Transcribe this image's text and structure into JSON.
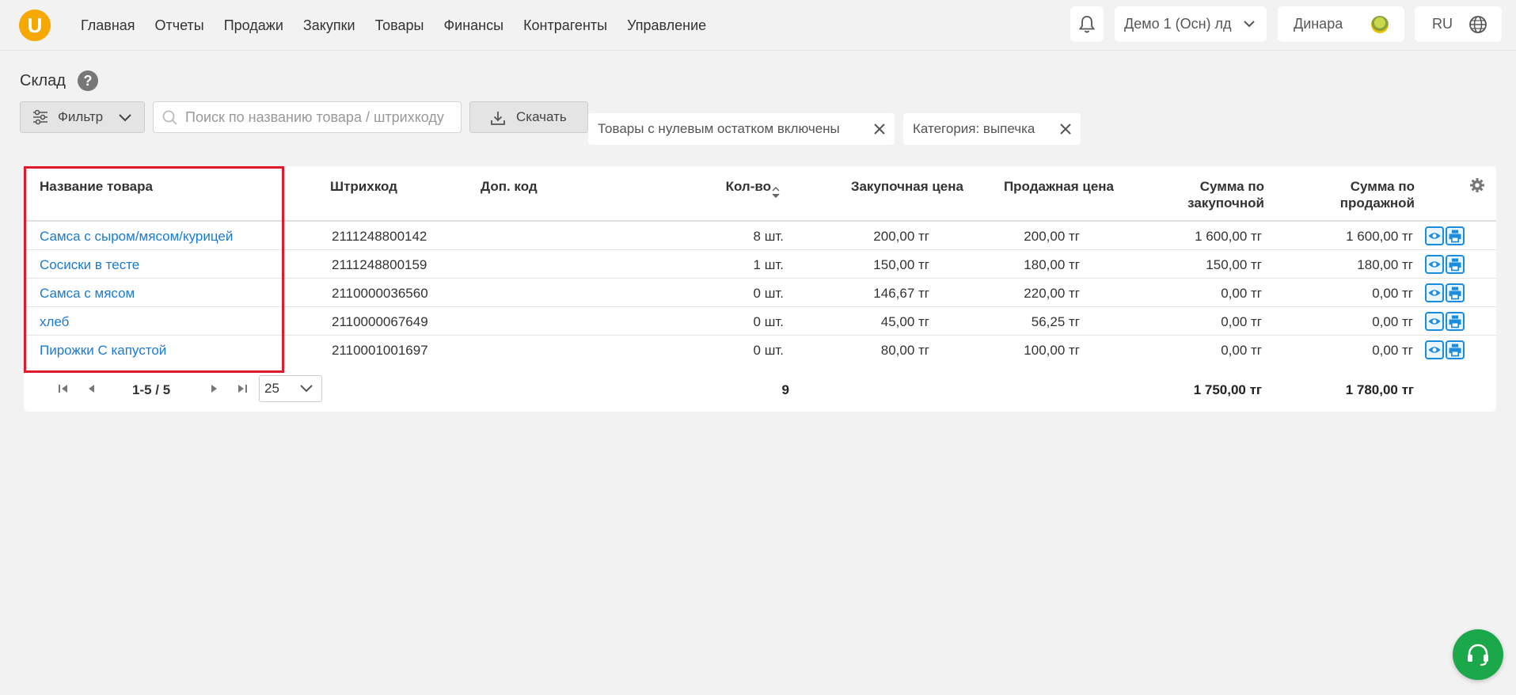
{
  "header": {
    "logo_letter": "U",
    "nav": [
      "Главная",
      "Отчеты",
      "Продажи",
      "Закупки",
      "Товары",
      "Финансы",
      "Контрагенты",
      "Управление"
    ],
    "company": "Демо 1 (Осн) лд",
    "user": "Динара",
    "language": "RU"
  },
  "page": {
    "title": "Склад",
    "help": "?",
    "filter_label": "Фильтр",
    "search_placeholder": "Поиск по названию товара / штрихкоду",
    "download_label": "Скачать",
    "chips": [
      "Товары с нулевым остатком включены",
      "Категория: выпечка"
    ]
  },
  "table": {
    "columns": {
      "name": "Название товара",
      "barcode": "Штрихкод",
      "extra_code": "Доп. код",
      "qty": "Кол-во",
      "purchase_price": "Закупочная цена",
      "sale_price": "Продажная цена",
      "sum_purchase_1": "Сумма по",
      "sum_purchase_2": "закупочной",
      "sum_sale_1": "Сумма по",
      "sum_sale_2": "продажной"
    },
    "rows": [
      {
        "name": "Самса с сыром/мясом/курицей",
        "barcode": "2111248800142",
        "extra_code": "",
        "qty": "8 шт.",
        "purchase_price": "200,00 тг",
        "sale_price": "200,00 тг",
        "sum_purchase": "1 600,00 тг",
        "sum_sale": "1 600,00 тг"
      },
      {
        "name": "Сосиски в тесте",
        "barcode": "2111248800159",
        "extra_code": "",
        "qty": "1 шт.",
        "purchase_price": "150,00 тг",
        "sale_price": "180,00 тг",
        "sum_purchase": "150,00 тг",
        "sum_sale": "180,00 тг"
      },
      {
        "name": "Самса с мясом",
        "barcode": "2110000036560",
        "extra_code": "",
        "qty": "0 шт.",
        "purchase_price": "146,67 тг",
        "sale_price": "220,00 тг",
        "sum_purchase": "0,00 тг",
        "sum_sale": "0,00 тг"
      },
      {
        "name": "хлеб",
        "barcode": "2110000067649",
        "extra_code": "",
        "qty": "0 шт.",
        "purchase_price": "45,00 тг",
        "sale_price": "56,25 тг",
        "sum_purchase": "0,00 тг",
        "sum_sale": "0,00 тг"
      },
      {
        "name": "Пирожки С капустой",
        "barcode": "2110001001697",
        "extra_code": "",
        "qty": "0 шт.",
        "purchase_price": "80,00 тг",
        "sale_price": "100,00 тг",
        "sum_purchase": "0,00 тг",
        "sum_sale": "0,00 тг"
      }
    ],
    "pager": {
      "range": "1-5 / 5",
      "page_size": "25"
    },
    "totals": {
      "qty": "9",
      "sum_purchase": "1 750,00 тг",
      "sum_sale": "1 780,00 тг"
    }
  },
  "colors": {
    "accent": "#1a7ad4",
    "logo": "#f6a800",
    "highlight": "#e01a2b",
    "support": "#1aa84a"
  }
}
